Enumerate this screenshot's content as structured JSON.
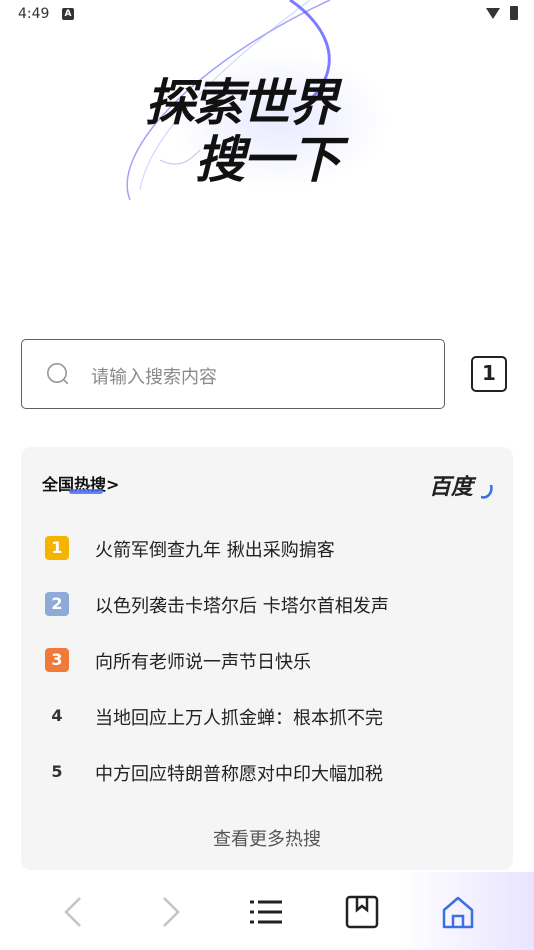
{
  "status_bar": {
    "time": "4:49",
    "notification_badge": "A",
    "wifi_icon": "wifi-icon",
    "battery_icon": "battery-icon"
  },
  "hero": {
    "line1": "探索世界",
    "line2": "搜一下"
  },
  "search": {
    "placeholder": "请输入搜索内容",
    "tab_count": "1"
  },
  "hot_list": {
    "title": "全国热搜>",
    "source_logo": "百度",
    "items": [
      {
        "rank": "1",
        "text": "火箭军倒查九年 揪出采购掮客",
        "rank_color": "#f5b400"
      },
      {
        "rank": "2",
        "text": "以色列袭击卡塔尔后 卡塔尔首相发声",
        "rank_color": "#8fa9d8"
      },
      {
        "rank": "3",
        "text": "向所有老师说一声节日快乐",
        "rank_color": "#f07a3a"
      },
      {
        "rank": "4",
        "text": "当地回应上万人抓金蝉：根本抓不完",
        "rank_color": ""
      },
      {
        "rank": "5",
        "text": "中方回应特朗普称愿对中印大幅加税",
        "rank_color": ""
      }
    ],
    "more_label": "查看更多热搜"
  },
  "bottom_nav": {
    "items": [
      "back-icon",
      "forward-icon",
      "menu-icon",
      "bookmark-icon",
      "home-icon"
    ],
    "accent_color": "#3b6fe6"
  }
}
